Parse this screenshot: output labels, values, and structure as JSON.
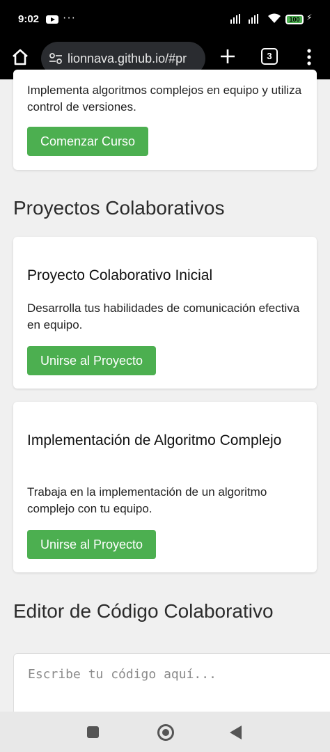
{
  "status_bar": {
    "time": "9:02",
    "battery": "100",
    "icons": [
      "youtube-icon",
      "more-dots-icon",
      "signal-icon",
      "wifi-icon",
      "battery-icon",
      "charging-icon"
    ]
  },
  "browser": {
    "url": "lionnava.github.io/#pr",
    "tab_count": "3",
    "icons": [
      "home-icon",
      "site-settings-icon",
      "new-tab-icon",
      "tabs-icon",
      "menu-icon"
    ]
  },
  "top_card": {
    "description": "Implementa algoritmos complejos en equipo y utiliza control de versiones.",
    "button_label": "Comenzar Curso"
  },
  "projects_section": {
    "title": "Proyectos Colaborativos",
    "projects": [
      {
        "title": "Proyecto Colaborativo Inicial",
        "description": "Desarrolla tus habilidades de comunicación efectiva en equipo.",
        "button_label": "Unirse al Proyecto"
      },
      {
        "title": "Implementación de Algoritmo Complejo",
        "description": "Trabaja en la implementación de un algoritmo complejo con tu equipo.",
        "button_label": "Unirse al Proyecto"
      }
    ]
  },
  "editor_section": {
    "title": "Editor de Código Colaborativo",
    "placeholder": "Escribe tu código aquí..."
  },
  "colors": {
    "accent_green": "#4caf50",
    "page_background": "#f0f0f0",
    "system_bar": "#000000"
  }
}
